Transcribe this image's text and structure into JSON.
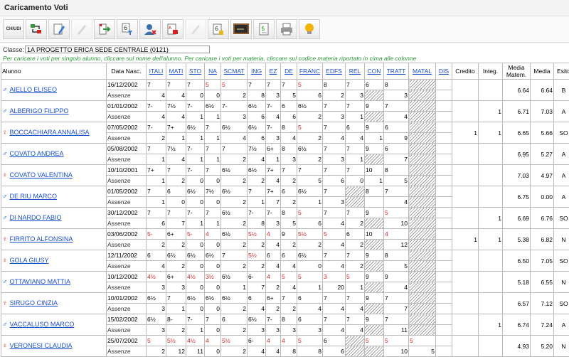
{
  "window": {
    "title": "Caricamento Voti"
  },
  "toolbar": {
    "close_label": "CHIUDI",
    "buttons": [
      {
        "name": "import-export-icon",
        "enabled": true
      },
      {
        "name": "edit-pencil-icon",
        "enabled": true
      },
      {
        "name": "disabled-tool-icon",
        "enabled": false
      },
      {
        "name": "import-arrow-icon",
        "enabled": true
      },
      {
        "name": "filter-6-icon",
        "enabled": true
      },
      {
        "name": "user-delete-icon",
        "enabled": true
      },
      {
        "name": "abc-sort-icon",
        "enabled": true
      },
      {
        "name": "disabled-tool-2-icon",
        "enabled": false
      },
      {
        "name": "grade-6-icon",
        "enabled": true
      },
      {
        "name": "blackboard-icon",
        "enabled": true
      },
      {
        "name": "money-document-icon",
        "enabled": true
      },
      {
        "name": "printer-icon",
        "enabled": true
      },
      {
        "name": "lightbulb-icon",
        "enabled": true
      }
    ]
  },
  "classe": {
    "label": "Classe:",
    "value": "1A PROGETTO ERICA SEDE CENTRALE (0121)"
  },
  "hint": "Per caricare i voti per singolo alunno, cliccare sul nome dell'alunno. Per caricare i voti per materia, cliccare sul codice materia riportato in cima alle colonne",
  "headers": {
    "alunno": "Alunno",
    "data": "Data Nasc.",
    "subjects": [
      "ITALI",
      "MATI",
      "STO",
      "NA",
      "SCMAT",
      "ING",
      "EZ",
      "DE",
      "FRANC",
      "EDFS",
      "REL",
      "CON",
      "TRATT",
      "MATAL",
      "DIS"
    ],
    "credito": "Credito",
    "integ": "Integ.",
    "media_matem": "Media Matem.",
    "media": "Media",
    "esito": "Esito"
  },
  "assenze_label": "Assenze",
  "students": [
    {
      "name": "AIELLO ELISEO",
      "sex": "M",
      "birth": "16/12/2002",
      "grades": [
        "7",
        "7",
        "7",
        "5",
        "5",
        "7",
        "7",
        "7",
        "5",
        "8",
        "7",
        "6",
        "8",
        "",
        ""
      ],
      "red": [
        3,
        4,
        8
      ],
      "absences": [
        "4",
        "4",
        "0",
        "0",
        "2",
        "8",
        "3",
        "5",
        "6",
        "2",
        "3",
        "",
        "3",
        "",
        ""
      ],
      "credito": "",
      "integ": "",
      "mm": "6.64",
      "media": "6.64",
      "esito": "B"
    },
    {
      "name": "ALBERIGO FILIPPO",
      "sex": "M",
      "birth": "01/01/2002",
      "grades": [
        "7-",
        "7½",
        "7-",
        "6½",
        "7-",
        "6½",
        "7-",
        "6",
        "6½",
        "7",
        "7",
        "9",
        "7",
        "",
        ""
      ],
      "red": [],
      "absences": [
        "4",
        "4",
        "1",
        "1",
        "3",
        "6",
        "4",
        "6",
        "2",
        "3",
        "1",
        "",
        "4",
        "",
        ""
      ],
      "credito": "",
      "integ": "1",
      "mm": "6.71",
      "media": "7.03",
      "esito": "A"
    },
    {
      "name": "BOCCACHIARA ANNALISA",
      "sex": "F",
      "birth": "07/05/2002",
      "grades": [
        "7-",
        "7+",
        "6½",
        "7",
        "6½",
        "6½",
        "7-",
        "8",
        "5",
        "7",
        "6",
        "9",
        "6",
        "",
        ""
      ],
      "red": [
        8
      ],
      "absences": [
        "2",
        "1",
        "1",
        "1",
        "4",
        "6",
        "3",
        "4",
        "2",
        "4",
        "4",
        "1",
        "9",
        "",
        ""
      ],
      "credito": "1",
      "integ": "1",
      "mm": "6.65",
      "media": "5.66",
      "esito": "SO"
    },
    {
      "name": "COVATO ANDREA",
      "sex": "M",
      "birth": "05/08/2002",
      "grades": [
        "7",
        "7½",
        "7-",
        "7",
        "7",
        "7½",
        "6+",
        "8",
        "6½",
        "7",
        "7",
        "9",
        "6",
        "",
        ""
      ],
      "red": [],
      "absences": [
        "1",
        "4",
        "1",
        "1",
        "2",
        "4",
        "1",
        "3",
        "2",
        "3",
        "1",
        "",
        "7",
        "",
        ""
      ],
      "credito": "",
      "integ": "",
      "mm": "6.95",
      "media": "5.27",
      "esito": "A"
    },
    {
      "name": "COVATO VALENTINA",
      "sex": "F",
      "birth": "10/10/2001",
      "grades": [
        "7+",
        "7",
        "7-",
        "7",
        "6½",
        "6½",
        "7+",
        "7",
        "7",
        "7",
        "7",
        "10",
        "8",
        "",
        ""
      ],
      "red": [],
      "absences": [
        "1",
        "2",
        "0",
        "0",
        "2",
        "2",
        "4",
        "2",
        "5",
        "6",
        "0",
        "1",
        "5",
        "",
        ""
      ],
      "credito": "",
      "integ": "",
      "mm": "7.03",
      "media": "4.97",
      "esito": "A"
    },
    {
      "name": "DE RIU MARCO",
      "sex": "M",
      "birth": "01/05/2002",
      "grades": [
        "7",
        "6",
        "6½",
        "7½",
        "6½",
        "7",
        "7+",
        "6",
        "6½",
        "7",
        "",
        "8",
        "7",
        "",
        ""
      ],
      "red": [],
      "absences": [
        "1",
        "0",
        "0",
        "0",
        "2",
        "1",
        "7",
        "2",
        "1",
        "3",
        "",
        "",
        "4",
        "",
        ""
      ],
      "credito": "",
      "integ": "",
      "mm": "6.75",
      "media": "0.00",
      "esito": "A"
    },
    {
      "name": "DI NARDO FABIO",
      "sex": "M",
      "birth": "30/12/2002",
      "grades": [
        "7",
        "7",
        "7-",
        "7",
        "6½",
        "7-",
        "7-",
        "8",
        "5",
        "7",
        "7",
        "9",
        "5",
        "",
        ""
      ],
      "red": [
        8,
        12
      ],
      "absences": [
        "6",
        "7",
        "1",
        "1",
        "2",
        "8",
        "3",
        "5",
        "6",
        "4",
        "2",
        "",
        "10",
        "",
        ""
      ],
      "credito": "",
      "integ": "1",
      "mm": "6.69",
      "media": "6.76",
      "esito": "SO"
    },
    {
      "name": "FIRRITO ALFONSINA",
      "sex": "F",
      "birth": "03/06/2002",
      "grades": [
        "5-",
        "6+",
        "5-",
        "4",
        "6½",
        "5½",
        "4",
        "9",
        "5½",
        "5",
        "6",
        "10",
        "4",
        "",
        ""
      ],
      "red": [
        0,
        2,
        3,
        5,
        6,
        8,
        9,
        12
      ],
      "absences": [
        "2",
        "2",
        "0",
        "0",
        "2",
        "2",
        "4",
        "2",
        "2",
        "4",
        "2",
        "",
        "12",
        "",
        ""
      ],
      "credito": "1",
      "integ": "1",
      "mm": "5.38",
      "media": "6.82",
      "esito": "N"
    },
    {
      "name": "GOLA GIUSY",
      "sex": "F",
      "birth": "12/11/2002",
      "grades": [
        "6",
        "6½",
        "6½",
        "6½",
        "7",
        "5½",
        "6",
        "6",
        "6½",
        "7",
        "7",
        "9",
        "8",
        "",
        ""
      ],
      "red": [
        5
      ],
      "absences": [
        "4",
        "2",
        "0",
        "0",
        "2",
        "2",
        "4",
        "4",
        "0",
        "4",
        "2",
        "",
        "5",
        "",
        ""
      ],
      "credito": "",
      "integ": "",
      "mm": "6.50",
      "media": "7.05",
      "esito": "SO"
    },
    {
      "name": "OTTAVIANO MATTIA",
      "sex": "M",
      "birth": "10/12/2002",
      "grades": [
        "4½",
        "6+",
        "4½",
        "3½",
        "6½",
        "6-",
        "4",
        "5",
        "5",
        "3",
        "5",
        "9",
        "9",
        "",
        ""
      ],
      "red": [
        0,
        2,
        3,
        6,
        7,
        8,
        9,
        10
      ],
      "absences": [
        "3",
        "3",
        "0",
        "0",
        "1",
        "7",
        "2",
        "4",
        "1",
        "20",
        "1",
        "",
        "4",
        "",
        ""
      ],
      "credito": "",
      "integ": "",
      "mm": "5.18",
      "media": "6.55",
      "esito": "N"
    },
    {
      "name": "SIRUGO CINZIA",
      "sex": "F",
      "birth": "10/01/2002",
      "grades": [
        "6½",
        "7",
        "6½",
        "6½",
        "6½",
        "6",
        "6+",
        "7",
        "6",
        "7",
        "7",
        "9",
        "7",
        "",
        ""
      ],
      "red": [],
      "absences": [
        "3",
        "1",
        "0",
        "0",
        "2",
        "4",
        "2",
        "2",
        "4",
        "4",
        "4",
        "",
        "7",
        "",
        ""
      ],
      "credito": "",
      "integ": "",
      "mm": "6.57",
      "media": "7.12",
      "esito": "SO"
    },
    {
      "name": "VACCALUSO MARCO",
      "sex": "M",
      "birth": "15/02/2002",
      "grades": [
        "6½",
        "8-",
        "7-",
        "7",
        "6",
        "6½",
        "7-",
        "8",
        "6",
        "7",
        "7",
        "9",
        "7",
        "",
        ""
      ],
      "red": [],
      "absences": [
        "3",
        "2",
        "1",
        "0",
        "2",
        "3",
        "3",
        "3",
        "3",
        "4",
        "4",
        "",
        "11",
        "",
        ""
      ],
      "credito": "",
      "integ": "1",
      "mm": "6.74",
      "media": "7.24",
      "esito": "A"
    },
    {
      "name": "VERONESI CLAUDIA",
      "sex": "F",
      "birth": "25/07/2002",
      "grades": [
        "5",
        "5½",
        "4½",
        "4",
        "5½",
        "6-",
        "4",
        "4",
        "5",
        "6",
        "",
        "5",
        "5",
        "5",
        ""
      ],
      "red": [
        0,
        1,
        2,
        3,
        4,
        6,
        7,
        8,
        11,
        12,
        13
      ],
      "absences": [
        "2",
        "12",
        "11",
        "0",
        "2",
        "4",
        "4",
        "8",
        "8",
        "6",
        "",
        "",
        "10",
        "5",
        ""
      ],
      "credito": "",
      "integ": "",
      "mm": "4.93",
      "media": "5.20",
      "esito": "N"
    }
  ]
}
